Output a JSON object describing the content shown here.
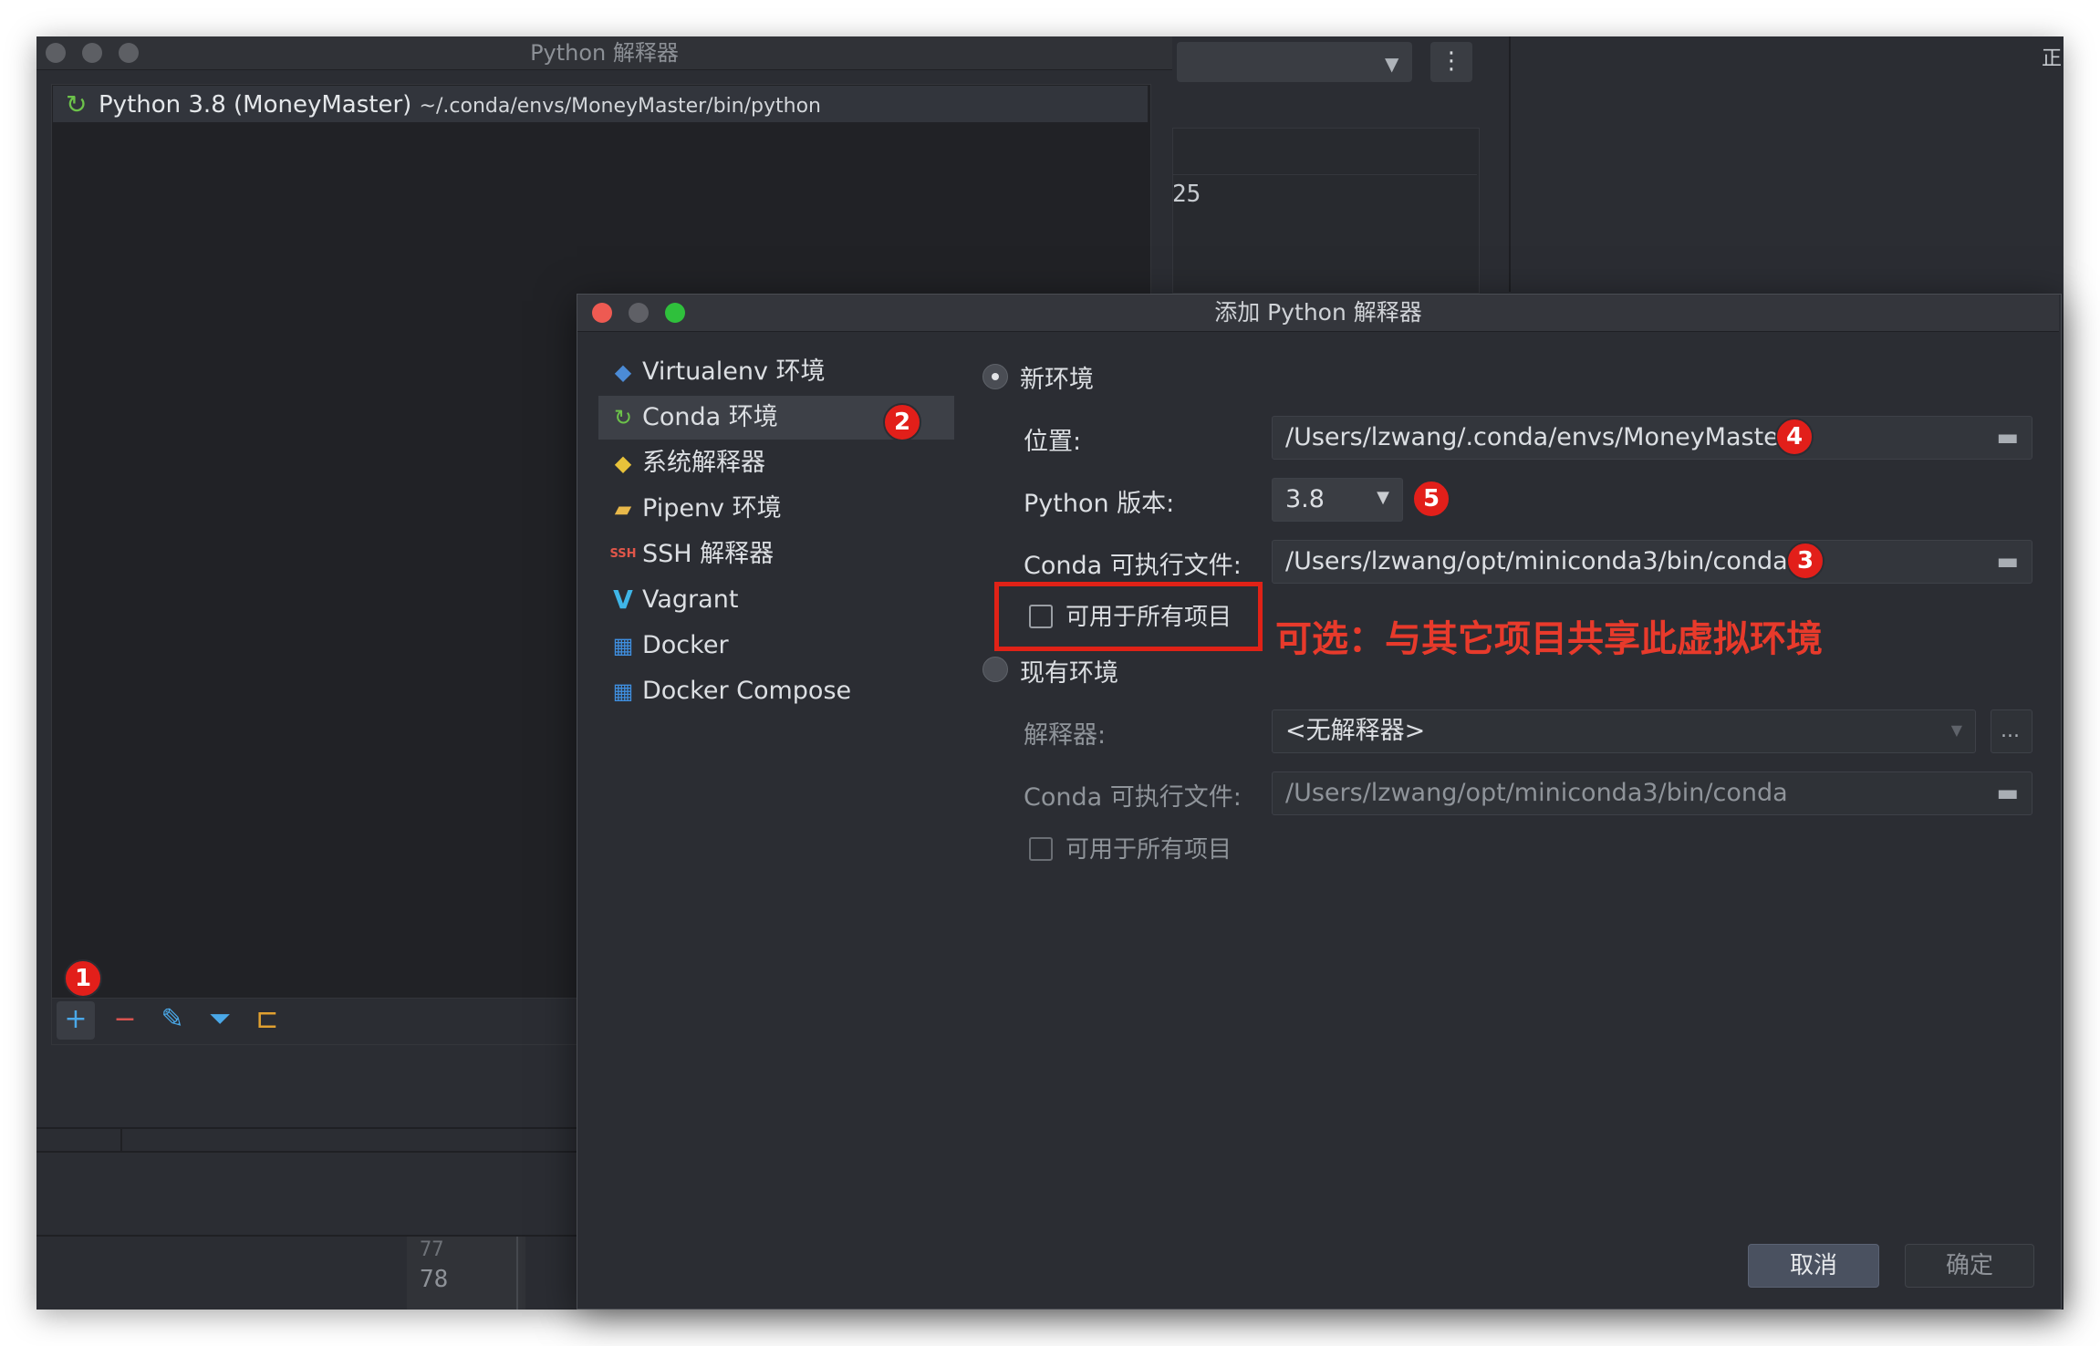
{
  "background_window": {
    "number_fragment": "25",
    "right_label": "正",
    "line_numbers": [
      "77",
      "78"
    ]
  },
  "interpreter_window": {
    "title": "Python 解释器",
    "selected_interpreter": {
      "name": "Python 3.8 (MoneyMaster)",
      "path": "~/.conda/envs/MoneyMaster/bin/python"
    },
    "toolbar": {
      "add": "+",
      "remove": "−",
      "edit": "✎",
      "filter": "⏷",
      "tree": "⊏"
    }
  },
  "dialog": {
    "title": "添加 Python 解释器",
    "sidebar": [
      {
        "label": "Virtualenv 环境",
        "icon": "python-icon"
      },
      {
        "label": "Conda 环境",
        "icon": "conda-icon"
      },
      {
        "label": "系统解释器",
        "icon": "python-icon"
      },
      {
        "label": "Pipenv 环境",
        "icon": "pipenv-folder-icon"
      },
      {
        "label": "SSH 解释器",
        "icon": "ssh-icon"
      },
      {
        "label": "Vagrant",
        "icon": "vagrant-icon"
      },
      {
        "label": "Docker",
        "icon": "docker-icon"
      },
      {
        "label": "Docker Compose",
        "icon": "docker-icon"
      }
    ],
    "new_env": {
      "label": "新环境",
      "location_label": "位置:",
      "location_value": "/Users/lzwang/.conda/envs/MoneyMaster",
      "python_version_label": "Python 版本:",
      "python_version_value": "3.8",
      "conda_exec_label": "Conda 可执行文件:",
      "conda_exec_value": "/Users/lzwang/opt/miniconda3/bin/conda",
      "available_all_label": "可用于所有项目"
    },
    "existing_env": {
      "label": "现有环境",
      "interpreter_label": "解释器:",
      "interpreter_value": "<无解释器>",
      "browse_label": "...",
      "conda_exec_label": "Conda 可执行文件:",
      "conda_exec_value": "/Users/lzwang/opt/miniconda3/bin/conda",
      "available_all_label": "可用于所有项目"
    },
    "cancel_label": "取消",
    "ok_label": "确定"
  },
  "annotations": {
    "badges": [
      "1",
      "2",
      "3",
      "4",
      "5"
    ],
    "note": "可选：与其它项目共享此虚拟环境",
    "highlight_color": "#e02217"
  },
  "colors": {
    "background": "#2b2d33",
    "selection": "#3d4047",
    "accent_red": "#e21f1a",
    "traffic_red": "#ee5a52",
    "traffic_yellow": "#5f6066",
    "traffic_green": "#2fc03c"
  }
}
